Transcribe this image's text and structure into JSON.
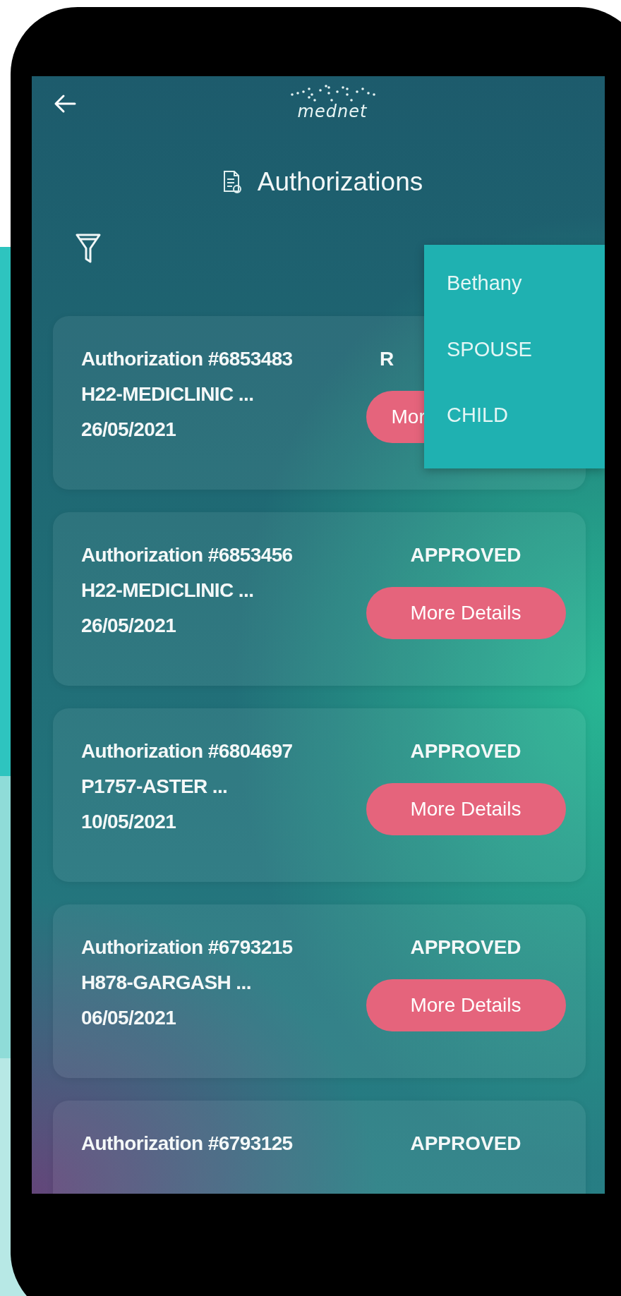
{
  "header": {
    "logo_text": "mednet"
  },
  "title": "Authorizations",
  "filter_menu": {
    "items": [
      {
        "label": "Bethany"
      },
      {
        "label": "SPOUSE"
      },
      {
        "label": "CHILD"
      }
    ]
  },
  "authorizations": [
    {
      "title": "Authorization #6853483",
      "provider": "H22-MEDICLINIC ...",
      "date": "26/05/2021",
      "status": "R",
      "button": "Mor"
    },
    {
      "title": "Authorization #6853456",
      "provider": "H22-MEDICLINIC ...",
      "date": "26/05/2021",
      "status": "APPROVED",
      "button": "More Details"
    },
    {
      "title": "Authorization #6804697",
      "provider": "P1757-ASTER ...",
      "date": "10/05/2021",
      "status": "APPROVED",
      "button": "More Details"
    },
    {
      "title": "Authorization #6793215",
      "provider": "H878-GARGASH ...",
      "date": "06/05/2021",
      "status": "APPROVED",
      "button": "More Details"
    },
    {
      "title": "Authorization #6793125",
      "status": "APPROVED"
    }
  ]
}
